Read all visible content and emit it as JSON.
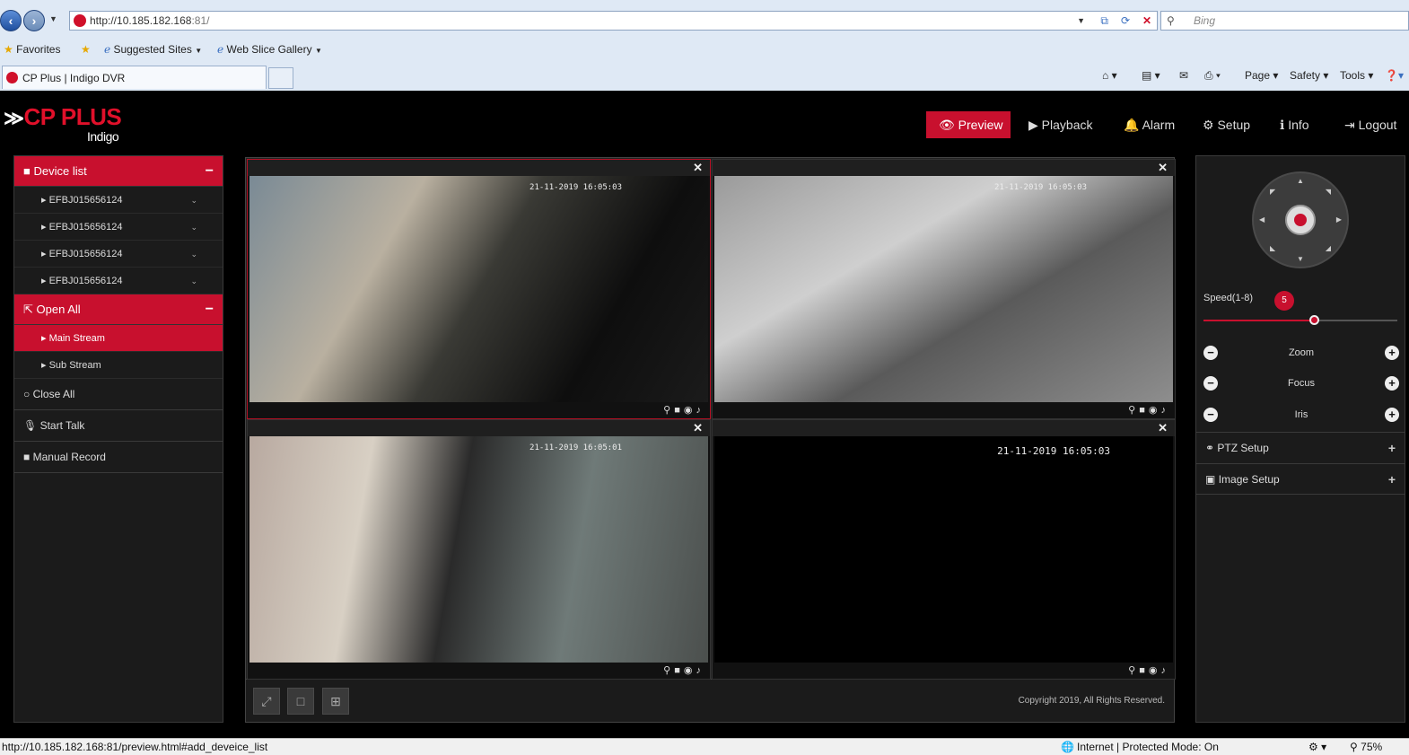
{
  "browser": {
    "url_main": "http://10.185.182.168",
    "url_port": ":81/",
    "search_placeholder": "Bing",
    "favorites_label": "Favorites",
    "suggested_sites": "Suggested Sites",
    "web_slice": "Web Slice Gallery",
    "tab_title": "CP Plus | Indigo DVR",
    "cmd_page": "Page",
    "cmd_safety": "Safety",
    "cmd_tools": "Tools"
  },
  "app": {
    "logo": "CP PLUS",
    "logo_sub": "Indigo",
    "nav": [
      {
        "label": "Preview",
        "icon": "eye-icon"
      },
      {
        "label": "Playback",
        "icon": "play-icon"
      },
      {
        "label": "Alarm",
        "icon": "bell-icon"
      },
      {
        "label": "Setup",
        "icon": "gear-icon"
      },
      {
        "label": "Info",
        "icon": "info-icon"
      },
      {
        "label": "Logout",
        "icon": "logout-icon"
      }
    ]
  },
  "left": {
    "device_list": "Device list",
    "devices": [
      "EFBJ015656124",
      "EFBJ015656124",
      "EFBJ015656124",
      "EFBJ015656124"
    ],
    "open_all": "Open All",
    "main_stream": "Main Stream",
    "sub_stream": "Sub Stream",
    "close_all": "Close All",
    "start_talk": "Start Talk",
    "manual_record": "Manual Record"
  },
  "grid": {
    "channels": [
      {
        "timestamp": "21-11-2019 16:05:03",
        "selected": true
      },
      {
        "timestamp": "21-11-2019 16:05:03",
        "selected": false
      },
      {
        "timestamp": "21-11-2019 16:05:01",
        "selected": false
      },
      {
        "timestamp": "21-11-2019 16:05:03",
        "selected": false
      }
    ],
    "copyright": "Copyright 2019, All Rights Reserved."
  },
  "right": {
    "speed_label": "Speed(1-8)",
    "speed_value": "5",
    "speed_fraction": 0.57,
    "zoom": "Zoom",
    "focus": "Focus",
    "iris": "Iris",
    "ptz_setup": "PTZ Setup",
    "image_setup": "Image Setup"
  },
  "status": {
    "link": "http://10.185.182.168:81/preview.html#add_deveice_list",
    "zone": "Internet | Protected Mode: On",
    "zoom": "75%"
  },
  "colors": {
    "accent": "#c8102e"
  }
}
